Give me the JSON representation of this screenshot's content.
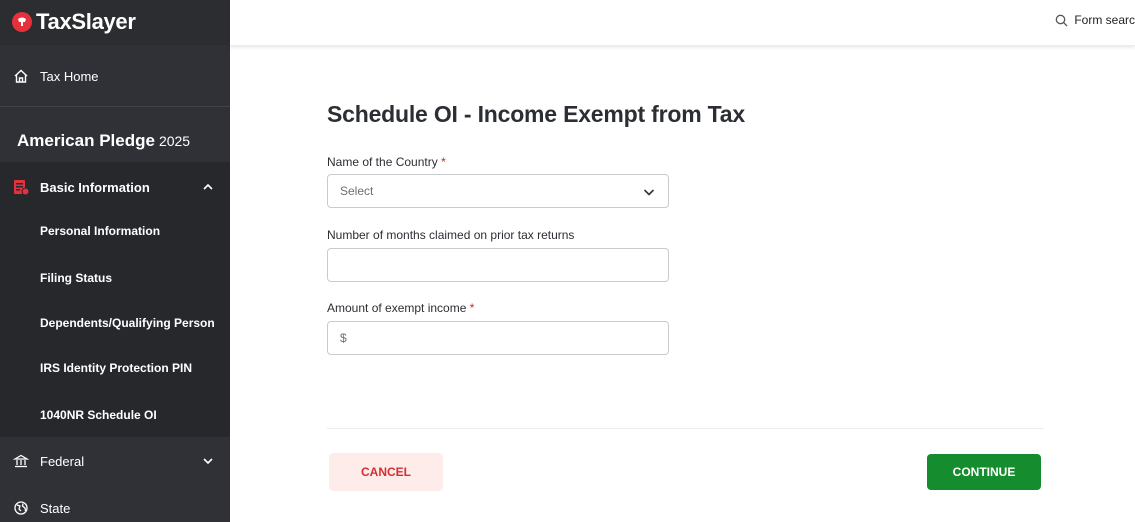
{
  "brand": {
    "name": "TaxSlayer",
    "accent": "#e4313c"
  },
  "sidebar": {
    "home_label": "Tax Home",
    "return_title": "American Pledge",
    "return_year": "2025",
    "basic": {
      "label": "Basic Information",
      "expanded": true,
      "items": [
        {
          "label": "Personal Information"
        },
        {
          "label": "Filing Status"
        },
        {
          "label": "Dependents/Qualifying Person"
        },
        {
          "label": "IRS Identity Protection PIN"
        },
        {
          "label": "1040NR Schedule OI"
        }
      ]
    },
    "federal_label": "Federal",
    "state_label": "State"
  },
  "topbar": {
    "search_label": "Form searc"
  },
  "main": {
    "title": "Schedule OI - Income Exempt from Tax",
    "country": {
      "label": "Name of the Country",
      "required_mark": "*",
      "selected": "Select"
    },
    "months": {
      "label": "Number of months claimed on prior tax returns",
      "value": ""
    },
    "amount": {
      "label": "Amount of exempt income",
      "required_mark": "*",
      "prefix": "$",
      "value": ""
    },
    "cancel_label": "CANCEL",
    "continue_label": "CONTINUE"
  },
  "colors": {
    "sidebar_bg": "#2f3136",
    "continue_bg": "#158c2e",
    "cancel_bg": "#fdecea",
    "cancel_text": "#d32f2f",
    "required": "#d1242f"
  }
}
